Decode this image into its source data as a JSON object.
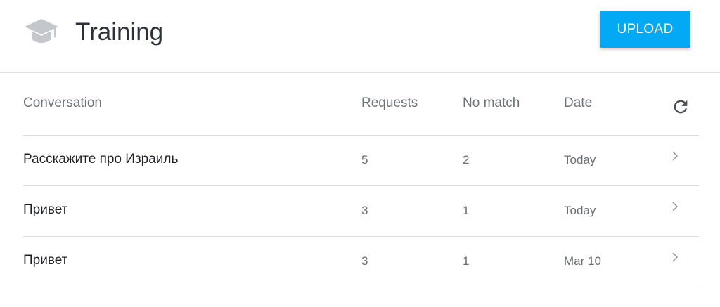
{
  "header": {
    "title": "Training",
    "upload_label": "UPLOAD",
    "icon": "graduation-cap-icon"
  },
  "colors": {
    "accent": "#03a9f4",
    "icon_gray": "#c4c7cc"
  },
  "table": {
    "columns": {
      "conversation": "Conversation",
      "requests": "Requests",
      "no_match": "No match",
      "date": "Date"
    },
    "refresh_icon": "refresh-icon",
    "rows": [
      {
        "conversation": "Расскажите про Израиль",
        "requests": "5",
        "no_match": "2",
        "date": "Today"
      },
      {
        "conversation": "Привет",
        "requests": "3",
        "no_match": "1",
        "date": "Today"
      },
      {
        "conversation": "Привет",
        "requests": "3",
        "no_match": "1",
        "date": "Mar 10"
      }
    ],
    "row_icon": "chevron-right-icon"
  }
}
